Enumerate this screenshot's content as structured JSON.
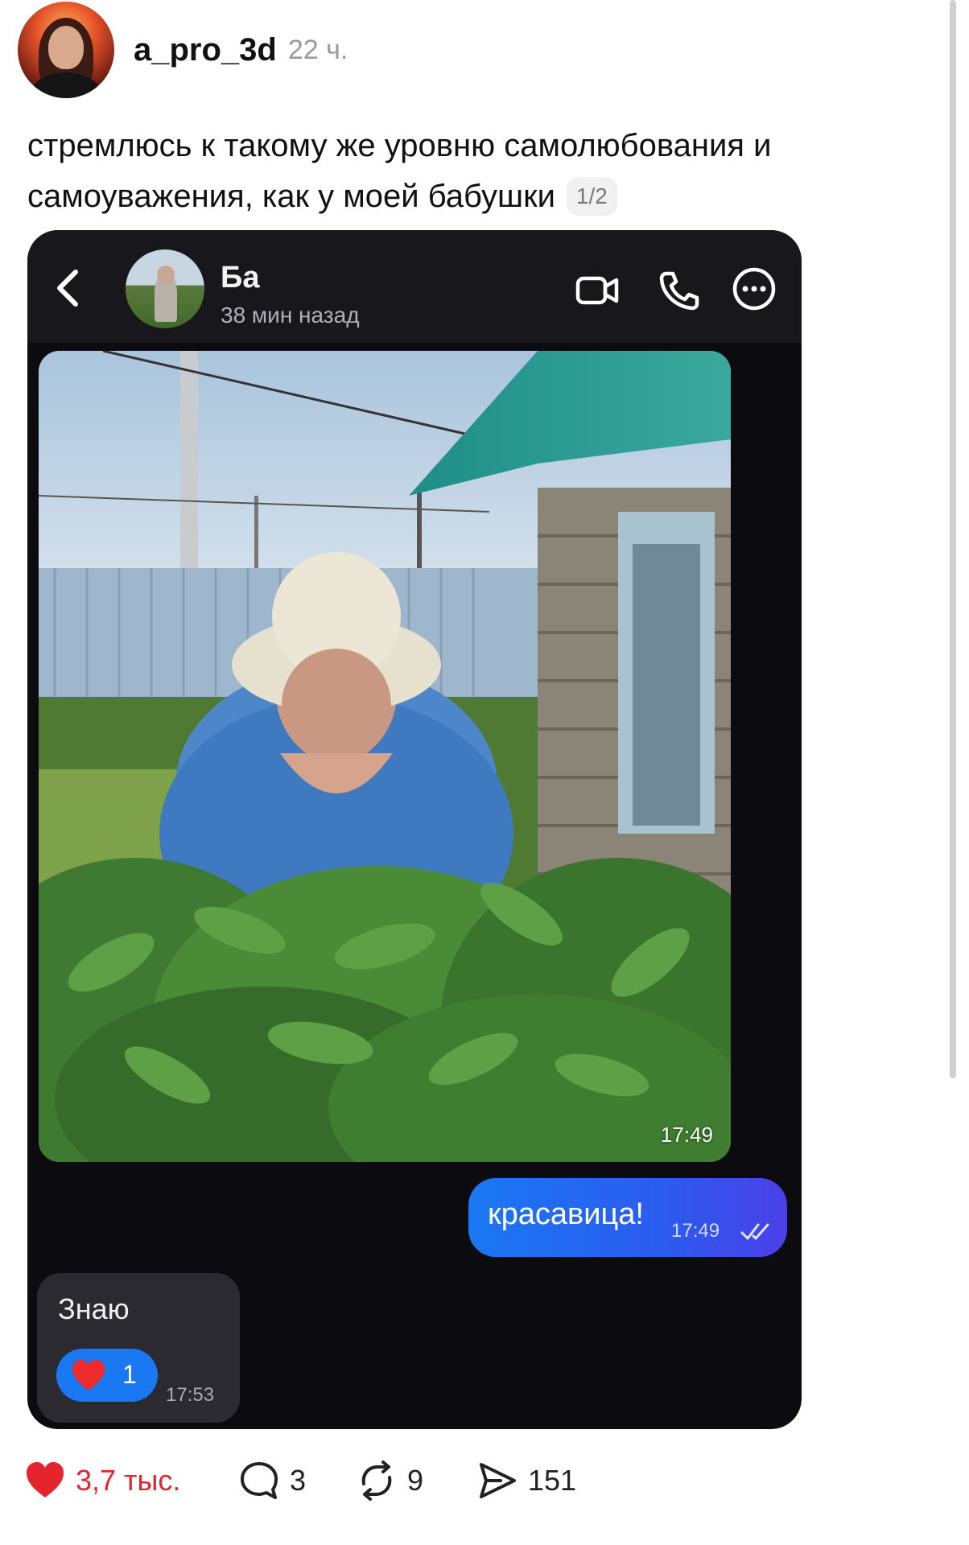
{
  "post": {
    "username": "a_pro_3d",
    "time": "22 ч.",
    "text": "стремлюсь к такому же уровню самолюбования и самоуважения, как у моей бабушки",
    "page_badge": "1/2"
  },
  "chat": {
    "contact_name": "Ба",
    "contact_status": "38 мин назад",
    "photo_time": "17:49",
    "outgoing": {
      "text": "красавица!",
      "time": "17:49"
    },
    "incoming": {
      "text": "Знаю",
      "reaction_count": "1",
      "time": "17:53"
    }
  },
  "actions": {
    "likes": "3,7 тыс.",
    "comments": "3",
    "reposts": "9",
    "views": "151"
  },
  "colors": {
    "accent_blue": "#1a78f2",
    "like_red": "#e5252d",
    "chat_bg": "#0c0c10"
  },
  "icons": [
    "back-icon",
    "video-call-icon",
    "phone-icon",
    "more-icon",
    "read-ticks-icon",
    "heart-icon",
    "comment-icon",
    "repost-icon",
    "share-icon"
  ]
}
